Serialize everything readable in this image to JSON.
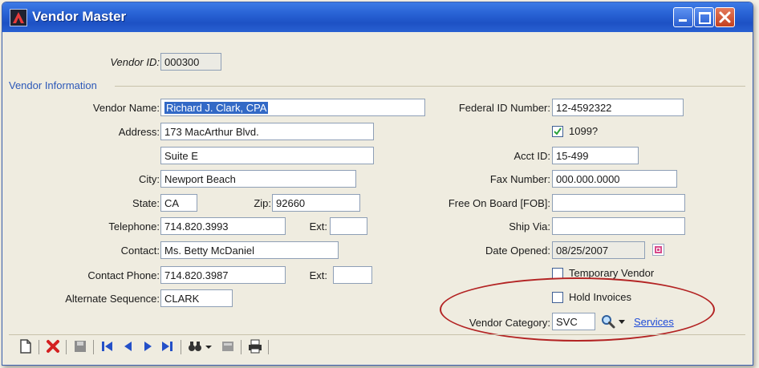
{
  "window": {
    "title": "Vendor Master"
  },
  "header": {
    "vendor_id_label": "Vendor ID:",
    "vendor_id_value": "000300"
  },
  "section_title": "Vendor Information",
  "left": {
    "vendor_name_label": "Vendor Name:",
    "vendor_name_value": "Richard J. Clark, CPA",
    "address_label": "Address:",
    "address1_value": "173 MacArthur Blvd.",
    "address2_value": "Suite E",
    "city_label": "City:",
    "city_value": "Newport Beach",
    "state_label": "State:",
    "state_value": "CA",
    "zip_label": "Zip:",
    "zip_value": "92660",
    "telephone_label": "Telephone:",
    "telephone_value": "714.820.3993",
    "ext_label": "Ext:",
    "ext_value": "",
    "contact_label": "Contact:",
    "contact_value": "Ms. Betty McDaniel",
    "contact_phone_label": "Contact Phone:",
    "contact_phone_value": "714.820.3987",
    "ext2_label": "Ext:",
    "ext2_value": "",
    "alt_seq_label": "Alternate Sequence:",
    "alt_seq_value": "CLARK"
  },
  "right": {
    "federal_id_label": "Federal ID Number:",
    "federal_id_value": "12-4592322",
    "form1099_label": "1099?",
    "form1099_checked": true,
    "acct_id_label": "Acct ID:",
    "acct_id_value": "15-499",
    "fax_label": "Fax Number:",
    "fax_value": "000.000.0000",
    "fob_label": "Free On Board [FOB]:",
    "fob_value": "",
    "ship_via_label": "Ship Via:",
    "ship_via_value": "",
    "date_opened_label": "Date Opened:",
    "date_opened_value": "08/25/2007",
    "temporary_vendor_label": "Temporary Vendor",
    "temporary_vendor_checked": false,
    "hold_invoices_label": "Hold Invoices",
    "hold_invoices_checked": false,
    "vendor_category_label": "Vendor Category:",
    "vendor_category_value": "SVC",
    "vendor_category_link": "Services"
  },
  "colors": {
    "titlebar": "#2a64d6",
    "highlight_oval": "#b32323",
    "link": "#1f4bd8",
    "selection": "#3269c6"
  }
}
